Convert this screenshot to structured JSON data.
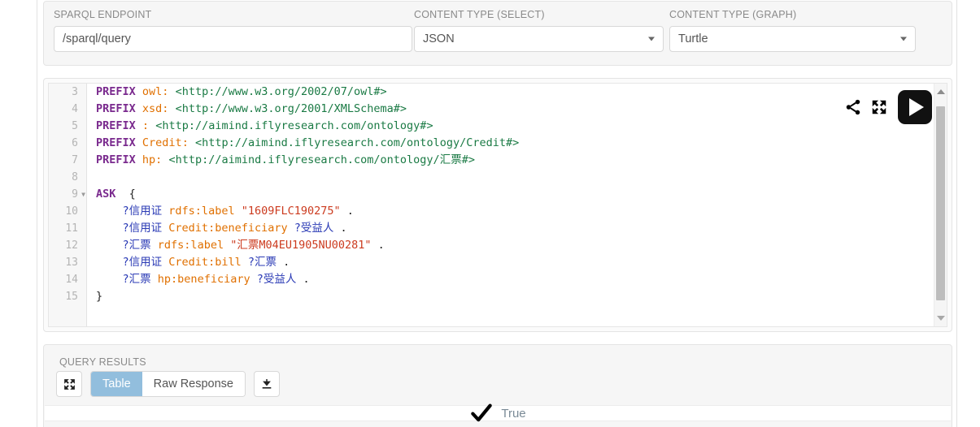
{
  "config": {
    "endpoint": {
      "label": "SPARQL ENDPOINT",
      "value": "/sparql/query",
      "placeholder": "/sparql/query"
    },
    "content_type_select": {
      "label": "CONTENT TYPE (SELECT)",
      "value": "JSON"
    },
    "content_type_graph": {
      "label": "CONTENT TYPE (GRAPH)",
      "value": "Turtle"
    }
  },
  "editor": {
    "icons": {
      "share": "share-icon",
      "fullscreen": "fullscreen-icon",
      "run": "play-icon"
    },
    "first_visible_line": 3,
    "lines": [
      {
        "number": "3",
        "fold": false,
        "tokens": [
          {
            "t": "PREFIX",
            "c": "kw"
          },
          {
            "t": " ",
            "c": "plain"
          },
          {
            "t": "owl:",
            "c": "pfx"
          },
          {
            "t": " ",
            "c": "plain"
          },
          {
            "t": "<http://www.w3.org/2002/07/owl#>",
            "c": "uri"
          }
        ]
      },
      {
        "number": "4",
        "fold": false,
        "tokens": [
          {
            "t": "PREFIX",
            "c": "kw"
          },
          {
            "t": " ",
            "c": "plain"
          },
          {
            "t": "xsd:",
            "c": "pfx"
          },
          {
            "t": " ",
            "c": "plain"
          },
          {
            "t": "<http://www.w3.org/2001/XMLSchema#>",
            "c": "uri"
          }
        ]
      },
      {
        "number": "5",
        "fold": false,
        "tokens": [
          {
            "t": "PREFIX",
            "c": "kw"
          },
          {
            "t": " ",
            "c": "plain"
          },
          {
            "t": ":",
            "c": "pfx"
          },
          {
            "t": " ",
            "c": "plain"
          },
          {
            "t": "<http://aimind.iflyresearch.com/ontology#>",
            "c": "uri"
          }
        ]
      },
      {
        "number": "6",
        "fold": false,
        "tokens": [
          {
            "t": "PREFIX",
            "c": "kw"
          },
          {
            "t": " ",
            "c": "plain"
          },
          {
            "t": "Credit:",
            "c": "pfx"
          },
          {
            "t": " ",
            "c": "plain"
          },
          {
            "t": "<http://aimind.iflyresearch.com/ontology/Credit#>",
            "c": "uri"
          }
        ]
      },
      {
        "number": "7",
        "fold": false,
        "tokens": [
          {
            "t": "PREFIX",
            "c": "kw"
          },
          {
            "t": " ",
            "c": "plain"
          },
          {
            "t": "hp:",
            "c": "pfx"
          },
          {
            "t": " ",
            "c": "plain"
          },
          {
            "t": "<http://aimind.iflyresearch.com/ontology/汇票#>",
            "c": "uri"
          }
        ]
      },
      {
        "number": "8",
        "fold": false,
        "tokens": []
      },
      {
        "number": "9",
        "fold": true,
        "tokens": [
          {
            "t": "ASK",
            "c": "kw"
          },
          {
            "t": "  {",
            "c": "plain"
          }
        ]
      },
      {
        "number": "10",
        "fold": false,
        "tokens": [
          {
            "t": "    ",
            "c": "plain"
          },
          {
            "t": "?信用证",
            "c": "var"
          },
          {
            "t": " ",
            "c": "plain"
          },
          {
            "t": "rdfs:label",
            "c": "pred"
          },
          {
            "t": " ",
            "c": "plain"
          },
          {
            "t": "\"1609FLC190275\"",
            "c": "lit"
          },
          {
            "t": " .",
            "c": "plain"
          }
        ]
      },
      {
        "number": "11",
        "fold": false,
        "tokens": [
          {
            "t": "    ",
            "c": "plain"
          },
          {
            "t": "?信用证",
            "c": "var"
          },
          {
            "t": " ",
            "c": "plain"
          },
          {
            "t": "Credit:beneficiary",
            "c": "pred"
          },
          {
            "t": " ",
            "c": "plain"
          },
          {
            "t": "?受益人",
            "c": "var"
          },
          {
            "t": " .",
            "c": "plain"
          }
        ]
      },
      {
        "number": "12",
        "fold": false,
        "tokens": [
          {
            "t": "    ",
            "c": "plain"
          },
          {
            "t": "?汇票",
            "c": "var"
          },
          {
            "t": " ",
            "c": "plain"
          },
          {
            "t": "rdfs:label",
            "c": "pred"
          },
          {
            "t": " ",
            "c": "plain"
          },
          {
            "t": "\"汇票M04EU1905NU00281\"",
            "c": "lit"
          },
          {
            "t": " .",
            "c": "plain"
          }
        ]
      },
      {
        "number": "13",
        "fold": false,
        "tokens": [
          {
            "t": "    ",
            "c": "plain"
          },
          {
            "t": "?信用证",
            "c": "var"
          },
          {
            "t": " ",
            "c": "plain"
          },
          {
            "t": "Credit:bill",
            "c": "pred"
          },
          {
            "t": " ",
            "c": "plain"
          },
          {
            "t": "?汇票",
            "c": "var"
          },
          {
            "t": " .",
            "c": "plain"
          }
        ]
      },
      {
        "number": "14",
        "fold": false,
        "tokens": [
          {
            "t": "    ",
            "c": "plain"
          },
          {
            "t": "?汇票",
            "c": "var"
          },
          {
            "t": " ",
            "c": "plain"
          },
          {
            "t": "hp:beneficiary",
            "c": "pred"
          },
          {
            "t": " ",
            "c": "plain"
          },
          {
            "t": "?受益人",
            "c": "var"
          },
          {
            "t": " .",
            "c": "plain"
          }
        ]
      },
      {
        "number": "15",
        "fold": false,
        "tokens": [
          {
            "t": "}",
            "c": "plain"
          }
        ]
      }
    ]
  },
  "results": {
    "label": "QUERY RESULTS",
    "fullscreen_icon": "fullscreen-icon",
    "download_icon": "download-icon",
    "tabs": [
      {
        "label": "Table",
        "active": true
      },
      {
        "label": "Raw Response",
        "active": false
      }
    ],
    "ask_result": {
      "icon": "checkmark-icon",
      "text": "True"
    }
  },
  "colors": {
    "accent_tab": "#92bedd",
    "keyword": "#7a2a8e",
    "prefix": "#e07000",
    "uri": "#1a7a44",
    "variable": "#2a3ab5",
    "literal": "#cc3b1f",
    "panel_bg": "#f6f6f6"
  }
}
